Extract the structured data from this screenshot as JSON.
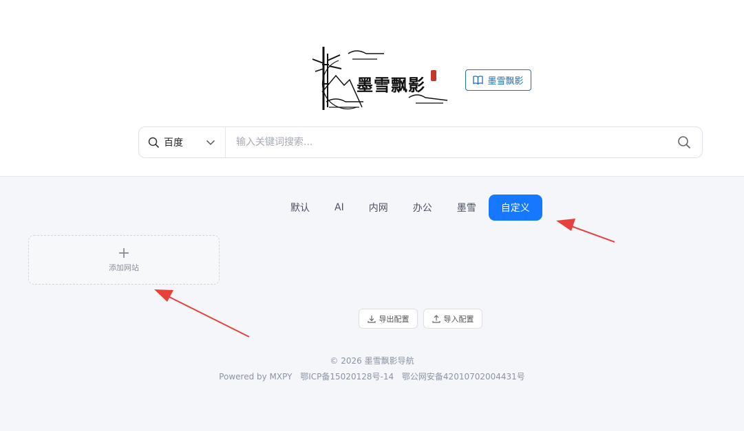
{
  "header": {
    "logo_text": "墨雪飘影",
    "site_button_label": "墨雪飘影"
  },
  "search": {
    "engine": "百度",
    "placeholder": "输入关键词搜索..."
  },
  "tabs": [
    {
      "label": "默认",
      "active": false
    },
    {
      "label": "AI",
      "active": false
    },
    {
      "label": "内网",
      "active": false
    },
    {
      "label": "办公",
      "active": false
    },
    {
      "label": "墨雪",
      "active": false
    },
    {
      "label": "自定义",
      "active": true
    }
  ],
  "custom": {
    "add_site_label": "添加网站"
  },
  "config": {
    "export_label": "导出配置",
    "import_label": "导入配置"
  },
  "footer": {
    "copyright": "© 2026 墨雪飘影导航",
    "powered": "Powered by MXPY",
    "icp": "鄂ICP备15020128号-14",
    "police": "鄂公网安备42010702004431号"
  },
  "colors": {
    "accent": "#1677ff",
    "site_button": "#1e6fb8",
    "annotation_arrow": "#e8413b"
  }
}
